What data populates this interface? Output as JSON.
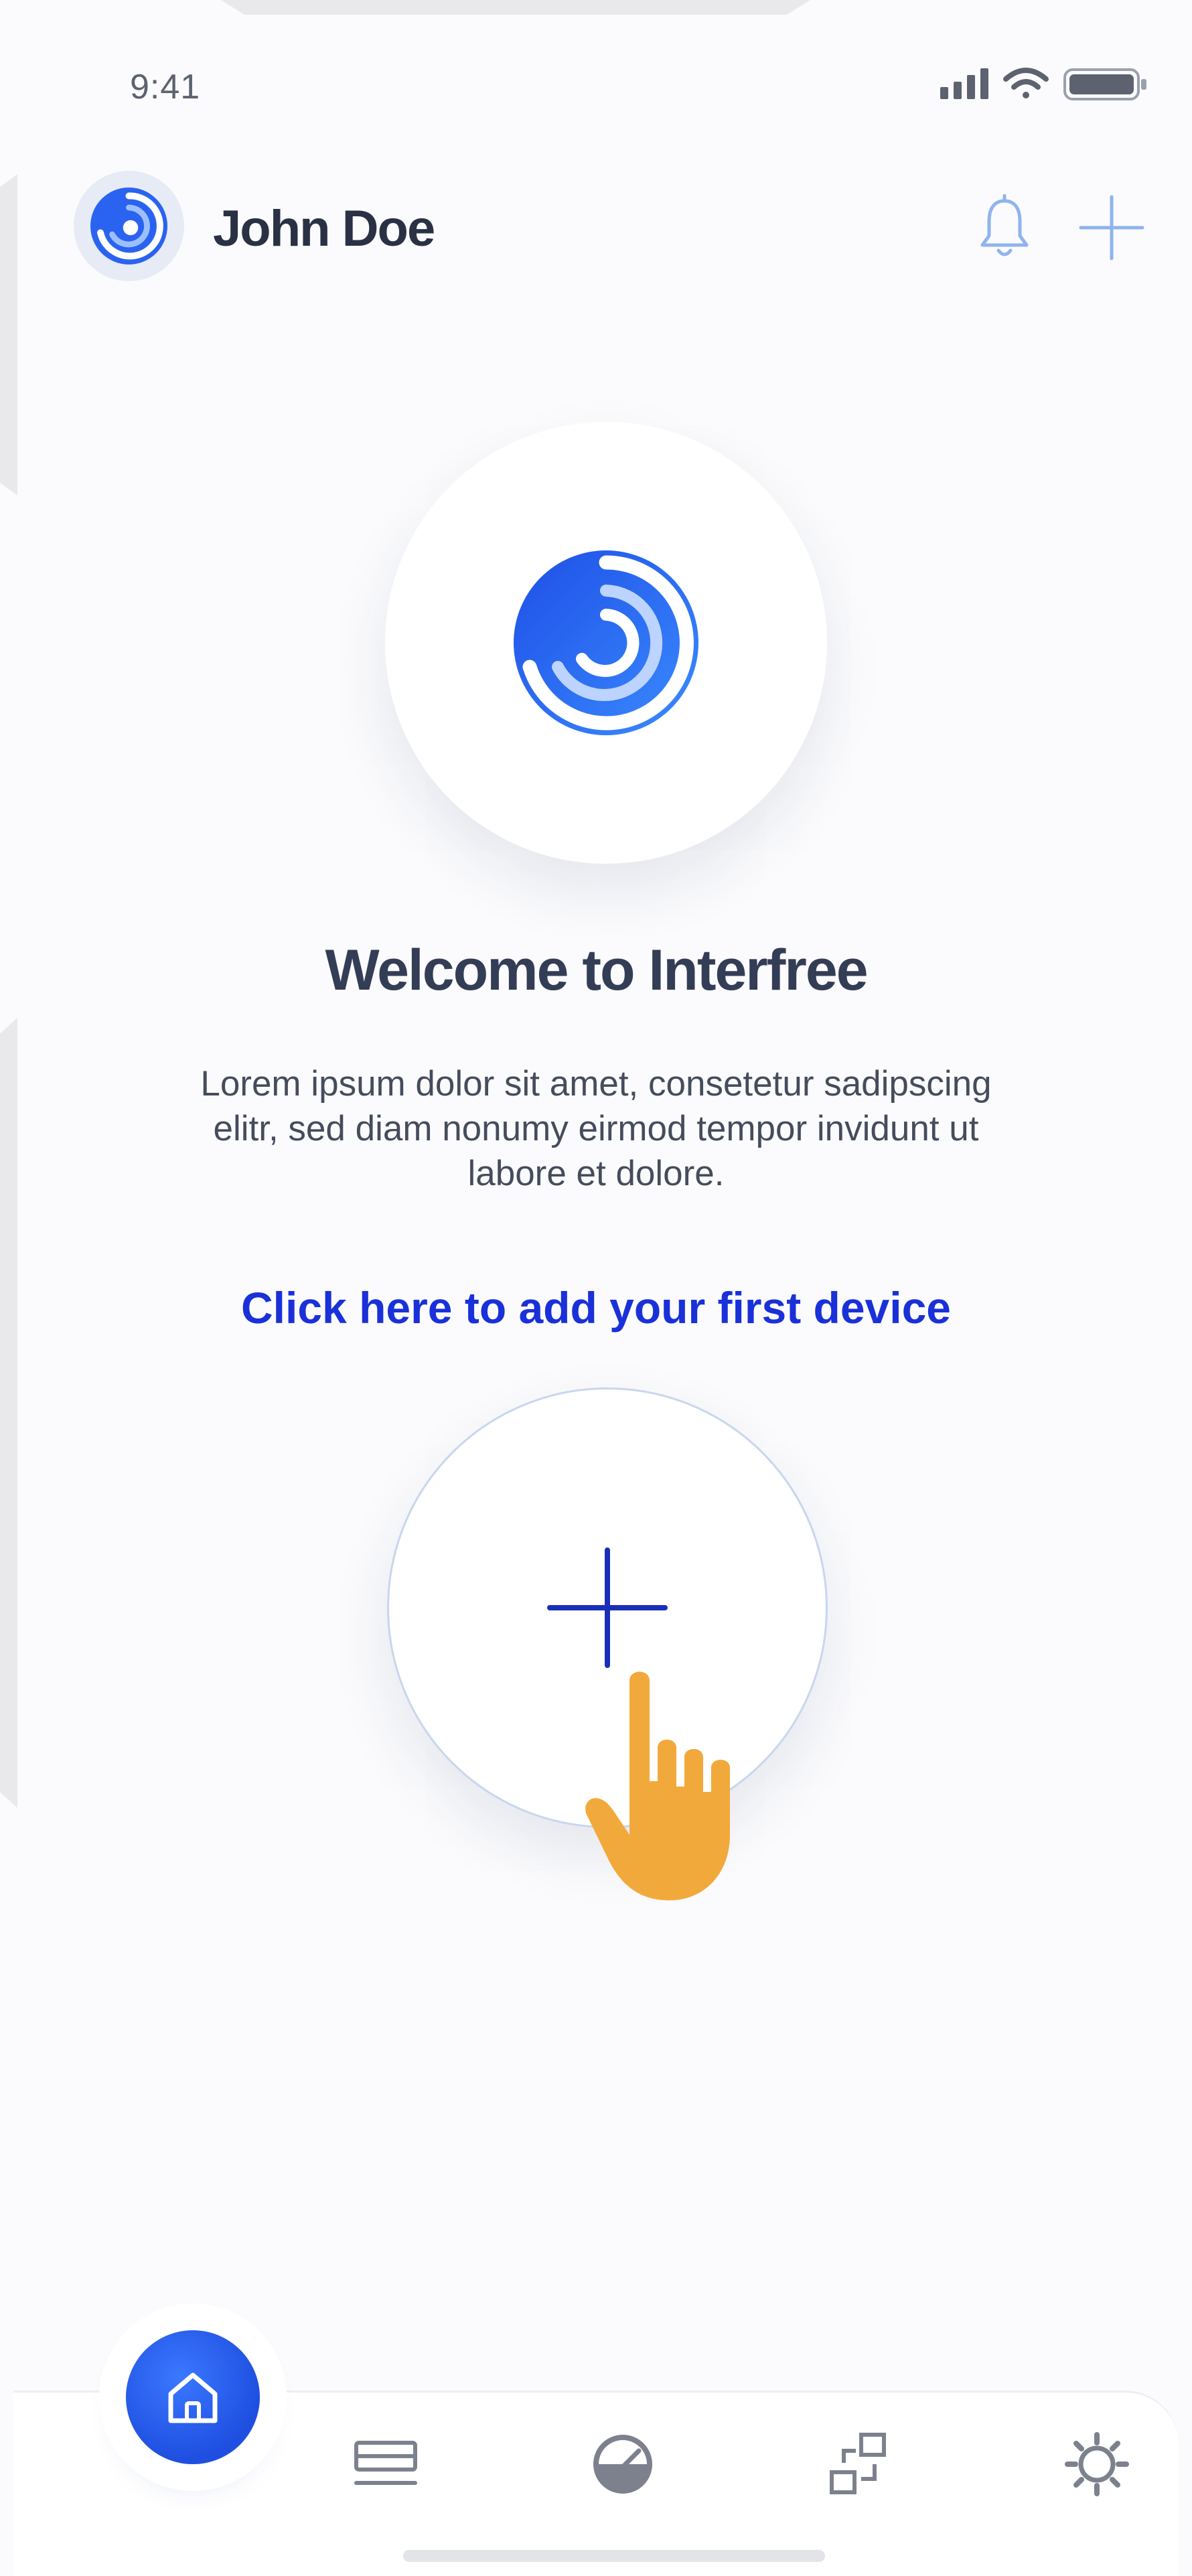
{
  "status_bar": {
    "time": "9:41",
    "icons": [
      "signal-icon",
      "wifi-icon",
      "battery-icon"
    ]
  },
  "header": {
    "user_name": "John Doe",
    "avatar_icon": "swirl-logo-icon",
    "actions": [
      "bell-icon",
      "plus-icon"
    ]
  },
  "main": {
    "logo_icon": "swirl-logo-icon",
    "welcome_title": "Welcome to Interfree",
    "description_lines": [
      "Lorem ipsum dolor sit amet, consetetur sadipscing",
      "elitr, sed diam nonumy eirmod tempor invidunt ut",
      "labore et dolore."
    ],
    "cta_text": "Click here to add your first device",
    "add_button_icon": "plus-icon",
    "pointer_icon": "hand-pointer-icon"
  },
  "bottom_nav": {
    "items": [
      "home-icon",
      "devices-icon",
      "gauge-icon",
      "scenes-icon",
      "settings-icon"
    ],
    "active": "home-icon"
  },
  "colors": {
    "accent": "#1a30d8",
    "home_button": "#2a63f0",
    "title": "#343d56",
    "hand": "#f2a93b"
  }
}
